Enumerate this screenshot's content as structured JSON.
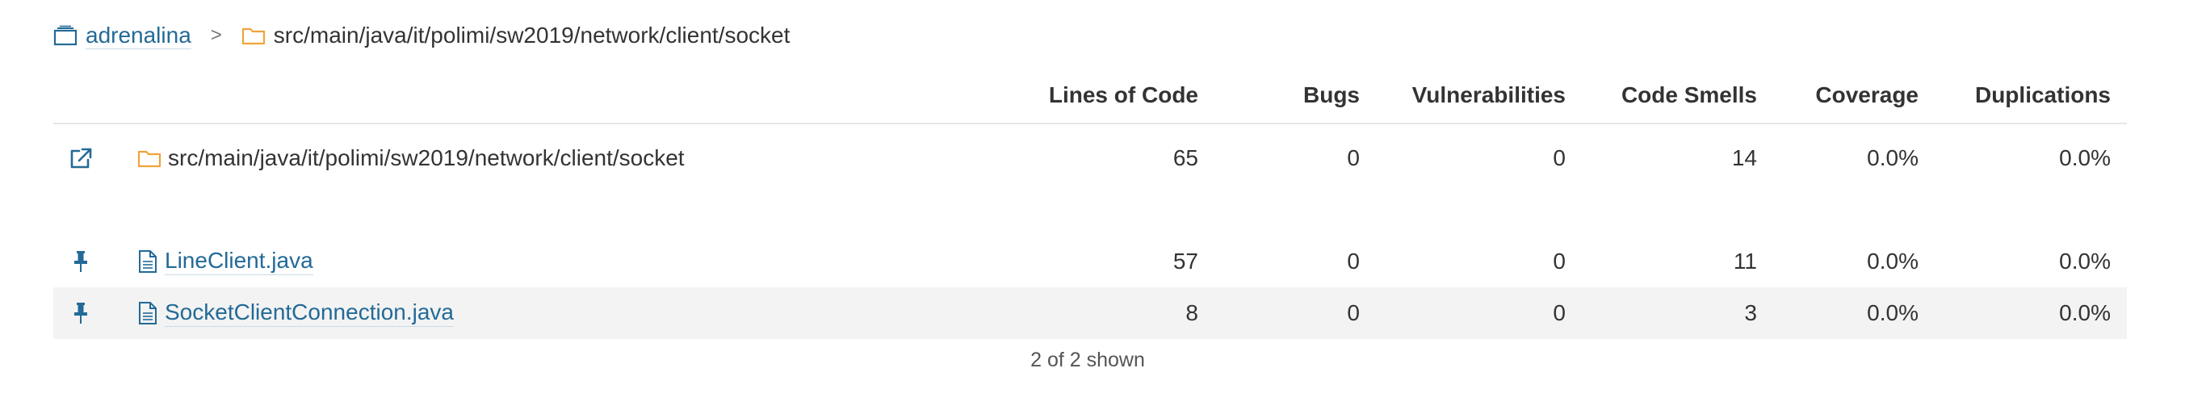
{
  "breadcrumb": {
    "project": "adrenalina",
    "separator": ">",
    "path": "src/main/java/it/polimi/sw2019/network/client/socket"
  },
  "columns": {
    "lines": "Lines of Code",
    "bugs": "Bugs",
    "vulnerabilities": "Vulnerabilities",
    "smells": "Code Smells",
    "coverage": "Coverage",
    "duplications": "Duplications"
  },
  "base_row": {
    "name": "src/main/java/it/polimi/sw2019/network/client/socket",
    "lines": "65",
    "bugs": "0",
    "vulnerabilities": "0",
    "smells": "14",
    "coverage": "0.0%",
    "duplications": "0.0%"
  },
  "files": [
    {
      "name": "LineClient.java",
      "lines": "57",
      "bugs": "0",
      "vulnerabilities": "0",
      "smells": "11",
      "coverage": "0.0%",
      "duplications": "0.0%"
    },
    {
      "name": "SocketClientConnection.java",
      "lines": "8",
      "bugs": "0",
      "vulnerabilities": "0",
      "smells": "3",
      "coverage": "0.0%",
      "duplications": "0.0%"
    }
  ],
  "footer": "2 of 2 shown",
  "colors": {
    "link": "#236a97",
    "folder": "#f0a33a",
    "row_alt": "#f3f3f3"
  },
  "icons": {
    "project": "project-icon",
    "folder": "folder-icon",
    "open_new": "external-link-icon",
    "pin": "pin-icon",
    "file": "file-icon"
  }
}
